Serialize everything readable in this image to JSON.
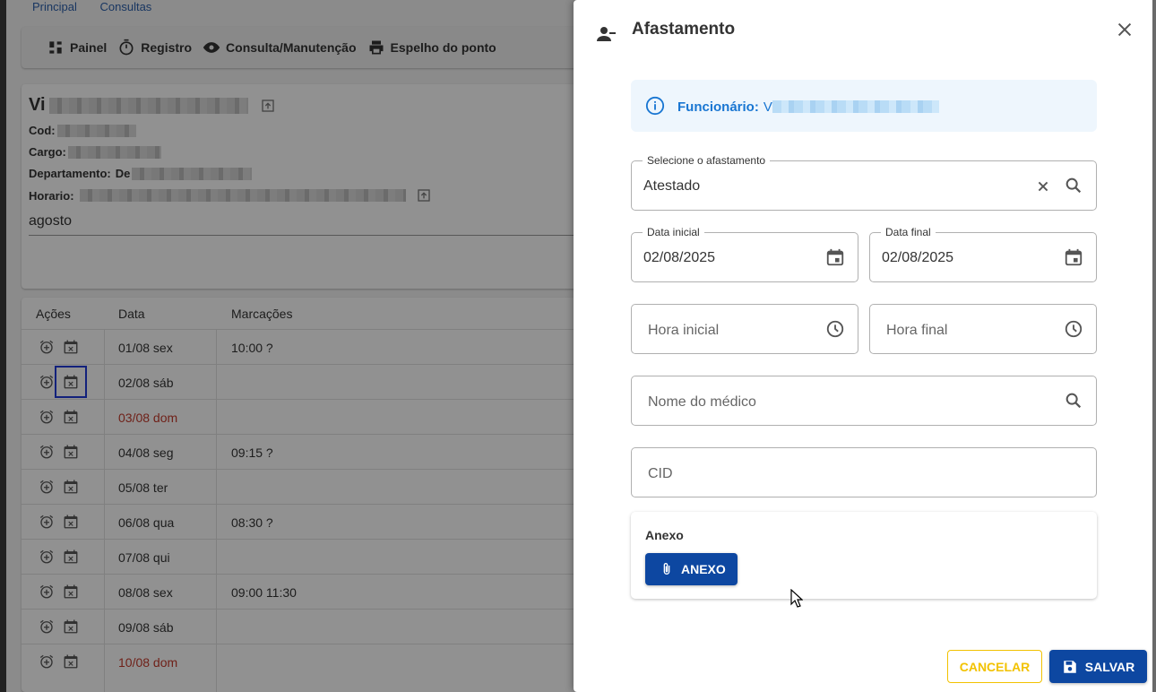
{
  "nav": {
    "links": [
      "Principal",
      "Consultas"
    ]
  },
  "toolbar": {
    "items": [
      {
        "label": "Painel",
        "icon": "dashboard-icon"
      },
      {
        "label": "Registro",
        "icon": "timer-icon"
      },
      {
        "label": "Consulta/Manutenção",
        "icon": "eye-icon"
      },
      {
        "label": "Espelho do ponto",
        "icon": "print-icon"
      }
    ]
  },
  "employee": {
    "name_prefix": "Vi",
    "cod_label": "Cod:",
    "cargo_label": "Cargo:",
    "departamento_label": "Departamento:",
    "departamento_prefix": "De",
    "horario_label": "Horario:",
    "month": "agosto"
  },
  "table": {
    "headers": [
      "Ações",
      "Data",
      "Marcações"
    ],
    "rows": [
      {
        "date": "01/08 sex",
        "marks": "10:00 ?",
        "weekend": false
      },
      {
        "date": "02/08 sáb",
        "marks": "",
        "weekend": false
      },
      {
        "date": "03/08 dom",
        "marks": "",
        "weekend": true
      },
      {
        "date": "04/08 seg",
        "marks": "09:15 ?",
        "weekend": false
      },
      {
        "date": "05/08 ter",
        "marks": "",
        "weekend": false
      },
      {
        "date": "06/08 qua",
        "marks": "08:30 ?",
        "weekend": false
      },
      {
        "date": "07/08 qui",
        "marks": "",
        "weekend": false
      },
      {
        "date": "08/08 sex",
        "marks": "09:00 11:30",
        "weekend": false
      },
      {
        "date": "09/08 sáb",
        "marks": "",
        "weekend": false
      },
      {
        "date": "10/08 dom",
        "marks": "",
        "weekend": true
      }
    ]
  },
  "dialog": {
    "title": "Afastamento",
    "info": {
      "label": "Funcionário:",
      "value_prefix": "V"
    },
    "afastamento": {
      "label": "Selecione o afastamento",
      "value": "Atestado"
    },
    "data_inicial": {
      "label": "Data inicial",
      "value": "02/08/2025"
    },
    "data_final": {
      "label": "Data final",
      "value": "02/08/2025"
    },
    "hora_inicial": {
      "placeholder": "Hora inicial"
    },
    "hora_final": {
      "placeholder": "Hora final"
    },
    "medico": {
      "placeholder": "Nome do médico"
    },
    "cid": {
      "placeholder": "CID"
    },
    "anexo": {
      "title": "Anexo",
      "button": "ANEXO"
    },
    "cancel": "CANCELAR",
    "save": "SALVAR"
  },
  "colors": {
    "primary": "#0d47a1",
    "info_blue": "#1976d2",
    "cancel_yellow": "#f2c200",
    "weekend_red": "#c0392b"
  }
}
